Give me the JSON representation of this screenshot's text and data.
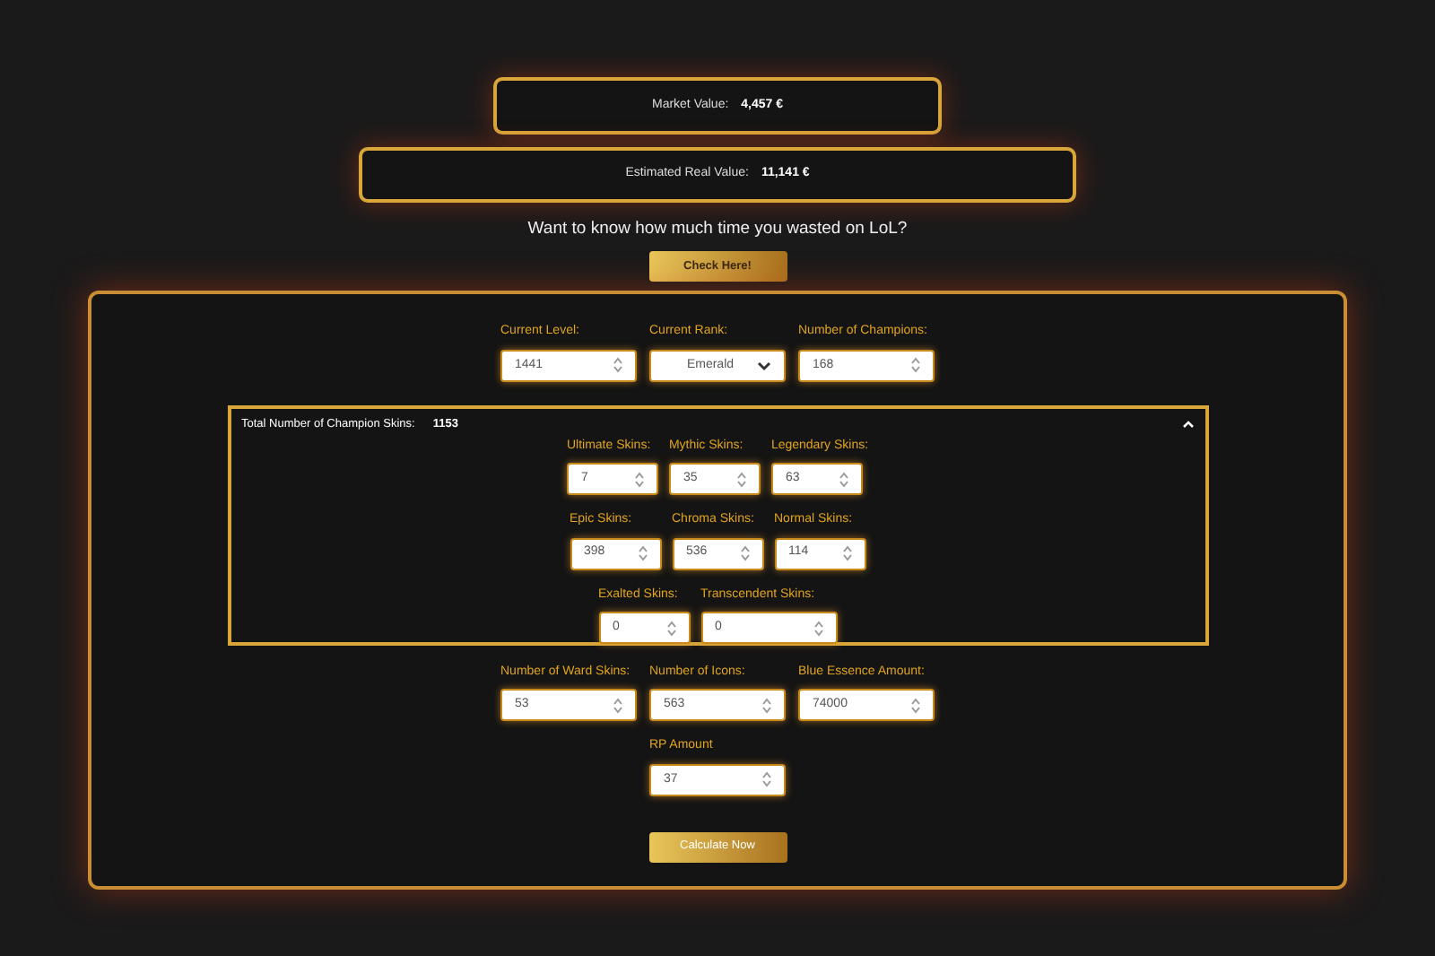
{
  "market_value": {
    "label": "Market Value:",
    "value": "4,457 €"
  },
  "real_value": {
    "label": "Estimated Real Value:",
    "value": "11,141 €"
  },
  "question": "Want to know how much time you wasted on LoL?",
  "check_button": "Check Here!",
  "top_fields": [
    {
      "label": "Current Level:",
      "value": "1441",
      "kind": "number"
    },
    {
      "label": "Current Rank:",
      "value": "Emerald",
      "kind": "select"
    },
    {
      "label": "Number of Champions:",
      "value": "168",
      "kind": "number"
    }
  ],
  "skins": {
    "label": "Total Number of Champion Skins:",
    "total": "1153",
    "expanded": true,
    "rows": [
      [
        {
          "label": "Ultimate Skins:",
          "value": "7",
          "kind": "number"
        },
        {
          "label": "Mythic Skins:",
          "value": "35",
          "kind": "number"
        },
        {
          "label": "Legendary Skins:",
          "value": "63",
          "kind": "number"
        }
      ],
      [
        {
          "label": "Epic Skins:",
          "value": "398",
          "kind": "number"
        },
        {
          "label": "Chroma Skins:",
          "value": "536",
          "kind": "number"
        },
        {
          "label": "Normal Skins:",
          "value": "114",
          "kind": "number"
        }
      ],
      [
        {
          "label": "Exalted Skins:",
          "value": "0",
          "kind": "number"
        },
        {
          "label": "Transcendent Skins:",
          "value": "0",
          "kind": "wide"
        }
      ]
    ]
  },
  "bottom_fields": [
    {
      "label": "Number of Ward Skins:",
      "value": "53"
    },
    {
      "label": "Number of Icons:",
      "value": "563"
    },
    {
      "label": "Blue Essence Amount:",
      "value": "74000"
    }
  ],
  "rp_field": {
    "label": "RP Amount",
    "value": "37"
  },
  "calculate_button": "Calculate Now"
}
